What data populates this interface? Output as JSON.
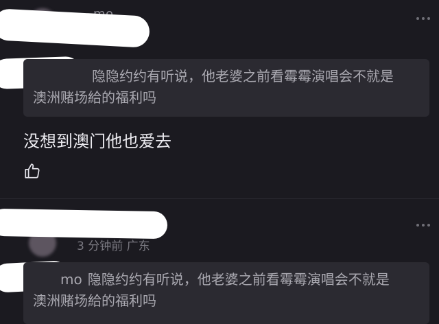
{
  "comment1": {
    "username": "mo",
    "meta": "",
    "quote": {
      "author": "",
      "text_line1": "隐隐约约有听说，他老婆之前看霉霉演唱会不就是",
      "text_line2": "澳洲赌场給的福利吗"
    },
    "body": "没想到澳门他也爱去"
  },
  "comment2": {
    "username": "",
    "meta": "3 分钟前 广东",
    "quote": {
      "author": "mo",
      "text_line1": "隐隐约约有听说，他老婆之前看霉霉演唱会不就是",
      "text_line2": "澳洲赌场給的福利吗"
    }
  },
  "icons": {
    "more": "more-dots-icon",
    "like": "thumbs-up-icon"
  }
}
